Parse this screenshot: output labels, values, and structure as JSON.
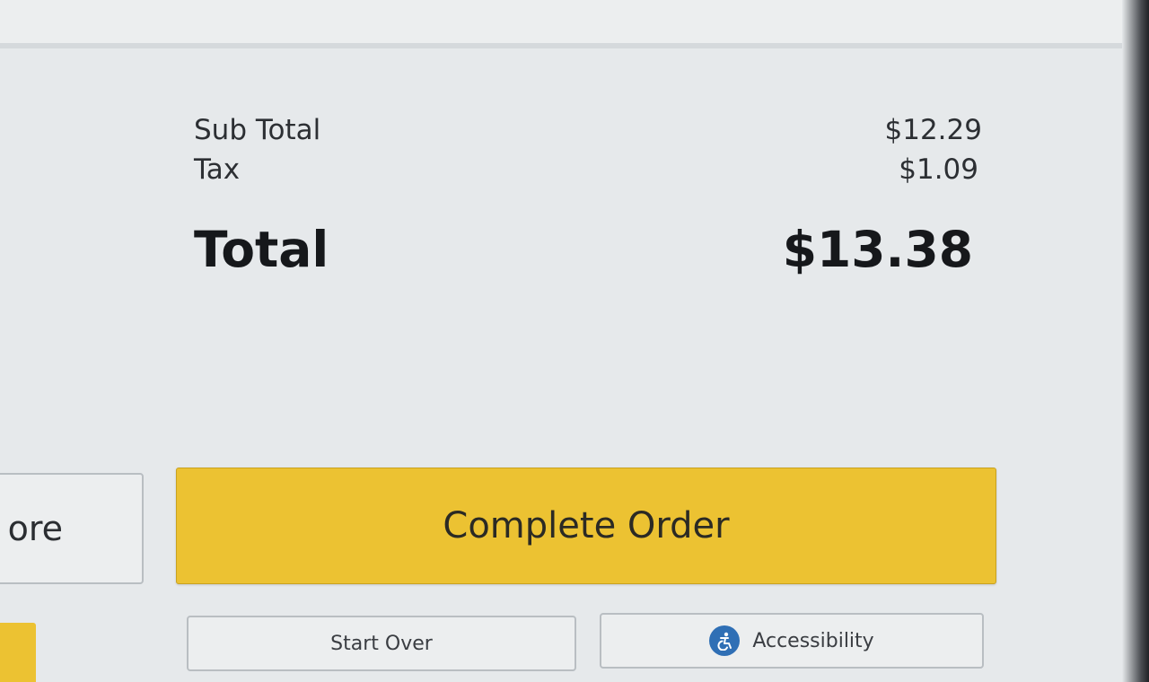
{
  "summary": {
    "subtotal_label": "Sub Total",
    "subtotal_value": "$12.29",
    "tax_label": "Tax",
    "tax_value": "$1.09",
    "total_label": "Total",
    "total_value": "$13.38"
  },
  "actions": {
    "more_label": "ore",
    "complete_label": "Complete Order",
    "start_over_label": "Start Over",
    "accessibility_label": "Accessibility",
    "accessibility_icon": "accessibility-icon"
  },
  "colors": {
    "primary_button": "#ecc232",
    "accessibility_icon_bg": "#2f6fb5",
    "background": "#e6e9eb"
  }
}
